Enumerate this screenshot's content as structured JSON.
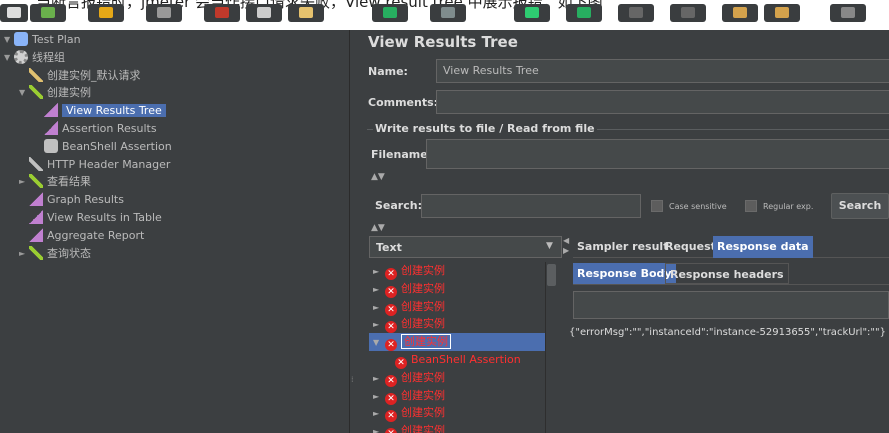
{
  "caption": "当断言报错时，jmeter 会当作接口请求失败，View result tree 中展示报错，如下图",
  "tree": {
    "items": [
      {
        "label": "Test Plan",
        "arrow": "▼",
        "icon": "flask-icon",
        "indent": 0,
        "selected": false
      },
      {
        "label": "线程组",
        "arrow": "▼",
        "icon": "gear-icon",
        "indent": 0,
        "selected": false
      },
      {
        "label": "创建实例_默认请求",
        "arrow": "",
        "icon": "sampler-icon",
        "indent": 1,
        "selected": false
      },
      {
        "label": "创建实例",
        "arrow": "▼",
        "icon": "controller-icon",
        "indent": 1,
        "selected": false
      },
      {
        "label": "View Results Tree",
        "arrow": "",
        "icon": "chart-icon",
        "indent": 2,
        "selected": true
      },
      {
        "label": "Assertion Results",
        "arrow": "",
        "icon": "chart-icon",
        "indent": 2,
        "selected": false
      },
      {
        "label": "BeanShell Assertion",
        "arrow": "",
        "icon": "magnifier-icon",
        "indent": 2,
        "selected": false
      },
      {
        "label": "HTTP Header Manager",
        "arrow": "",
        "icon": "wrench-icon",
        "indent": 1,
        "selected": false
      },
      {
        "label": "查看结果",
        "arrow": "►",
        "icon": "controller-icon",
        "indent": 1,
        "selected": false
      },
      {
        "label": "Graph Results",
        "arrow": "",
        "icon": "chart-icon",
        "indent": 1,
        "selected": false
      },
      {
        "label": "View Results in Table",
        "arrow": "",
        "icon": "chart-icon",
        "indent": 1,
        "selected": false
      },
      {
        "label": "Aggregate Report",
        "arrow": "",
        "icon": "chart-icon",
        "indent": 1,
        "selected": false
      },
      {
        "label": "查询状态",
        "arrow": "►",
        "icon": "controller-icon",
        "indent": 1,
        "selected": false
      }
    ]
  },
  "panel": {
    "title": "View Results Tree",
    "name_label": "Name:",
    "name_value": "View Results Tree",
    "comments_label": "Comments:",
    "comments_value": "",
    "file_section": "Write results to file / Read from file",
    "filename_label": "Filename",
    "search_label": "Search:",
    "case_sensitive": "Case sensitive",
    "regular_exp": "Regular exp.",
    "search_button": "Search",
    "renderer": "Text",
    "tabs": [
      "Sampler result",
      "Request",
      "Response data"
    ],
    "subtabs": [
      "Response Body",
      "Response headers"
    ],
    "response_body": "{\"errorMsg\":\"\",\"instanceId\":\"instance-52913655\",\"trackUrl\":\"\"}"
  },
  "results": [
    {
      "label": "创建实例",
      "arrow": "►",
      "child": false,
      "selected": false
    },
    {
      "label": "创建实例",
      "arrow": "►",
      "child": false,
      "selected": false
    },
    {
      "label": "创建实例",
      "arrow": "►",
      "child": false,
      "selected": false
    },
    {
      "label": "创建实例",
      "arrow": "►",
      "child": false,
      "selected": false
    },
    {
      "label": "创建实例",
      "arrow": "▼",
      "child": false,
      "selected": true
    },
    {
      "label": "BeanShell Assertion",
      "arrow": "",
      "child": true,
      "selected": false
    },
    {
      "label": "创建实例",
      "arrow": "►",
      "child": false,
      "selected": false
    },
    {
      "label": "创建实例",
      "arrow": "►",
      "child": false,
      "selected": false
    },
    {
      "label": "创建实例",
      "arrow": "►",
      "child": false,
      "selected": false
    },
    {
      "label": "创建实例",
      "arrow": "►",
      "child": false,
      "selected": false
    }
  ]
}
